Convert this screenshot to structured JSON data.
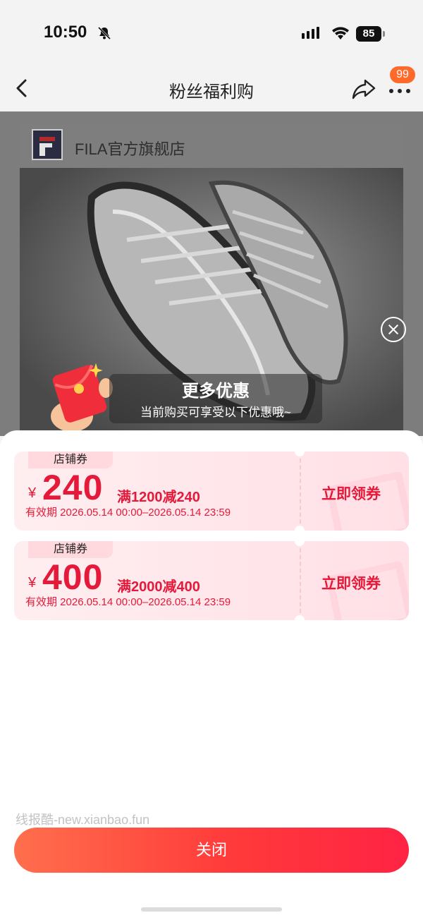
{
  "status_bar": {
    "time": "10:50",
    "battery": "85"
  },
  "nav": {
    "title": "粉丝福利购",
    "badge": "99"
  },
  "store": {
    "name": "FILA官方旗舰店"
  },
  "promo_banner": {
    "title": "更多优惠",
    "subtitle": "当前购买可享受以下优惠哦~"
  },
  "coupons": [
    {
      "tag": "店铺券",
      "currency": "¥",
      "amount": "240",
      "condition": "满1200减240",
      "validity": "有效期 2026.05.14 00:00–2026.05.14 23:59",
      "action": "立即领券"
    },
    {
      "tag": "店铺券",
      "currency": "¥",
      "amount": "400",
      "condition": "满2000减400",
      "validity": "有效期 2026.05.14 00:00–2026.05.14 23:59",
      "action": "立即领券"
    }
  ],
  "watermark": "线报酷-new.xianbao.fun",
  "footer": {
    "close_label": "关闭"
  },
  "colors": {
    "accent": "#e5193a",
    "button_start": "#ff6f4d",
    "button_end": "#ff2344"
  }
}
